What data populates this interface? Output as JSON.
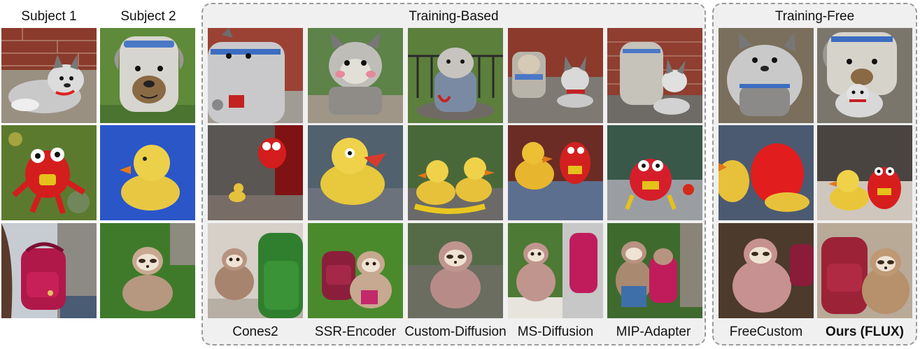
{
  "headers": {
    "subject_1": "Subject 1",
    "subject_2": "Subject 2",
    "training_based": "Training-Based",
    "training_free": "Training-Free"
  },
  "methods": {
    "cones2": "Cones2",
    "ssr_encoder": "SSR-Encoder",
    "custom_diffusion": "Custom-Diffusion",
    "ms_diffusion": "MS-Diffusion",
    "mip_adapter": "MIP-Adapter",
    "freecustom": "FreeCustom",
    "ours": "Ours (FLUX)"
  },
  "colors": {
    "husky_bg": "#8a3b2c",
    "backpack_bg": "#5e8a3a",
    "red_toy_bg": "#5b7a2e",
    "duck_bg": "#2a56c8",
    "pink_backpack_bg": "#c7ccd2",
    "sloth_bg": "#3f7a2a",
    "box_border": "#9a9a9a",
    "box_fill": "#f0f0f0"
  }
}
